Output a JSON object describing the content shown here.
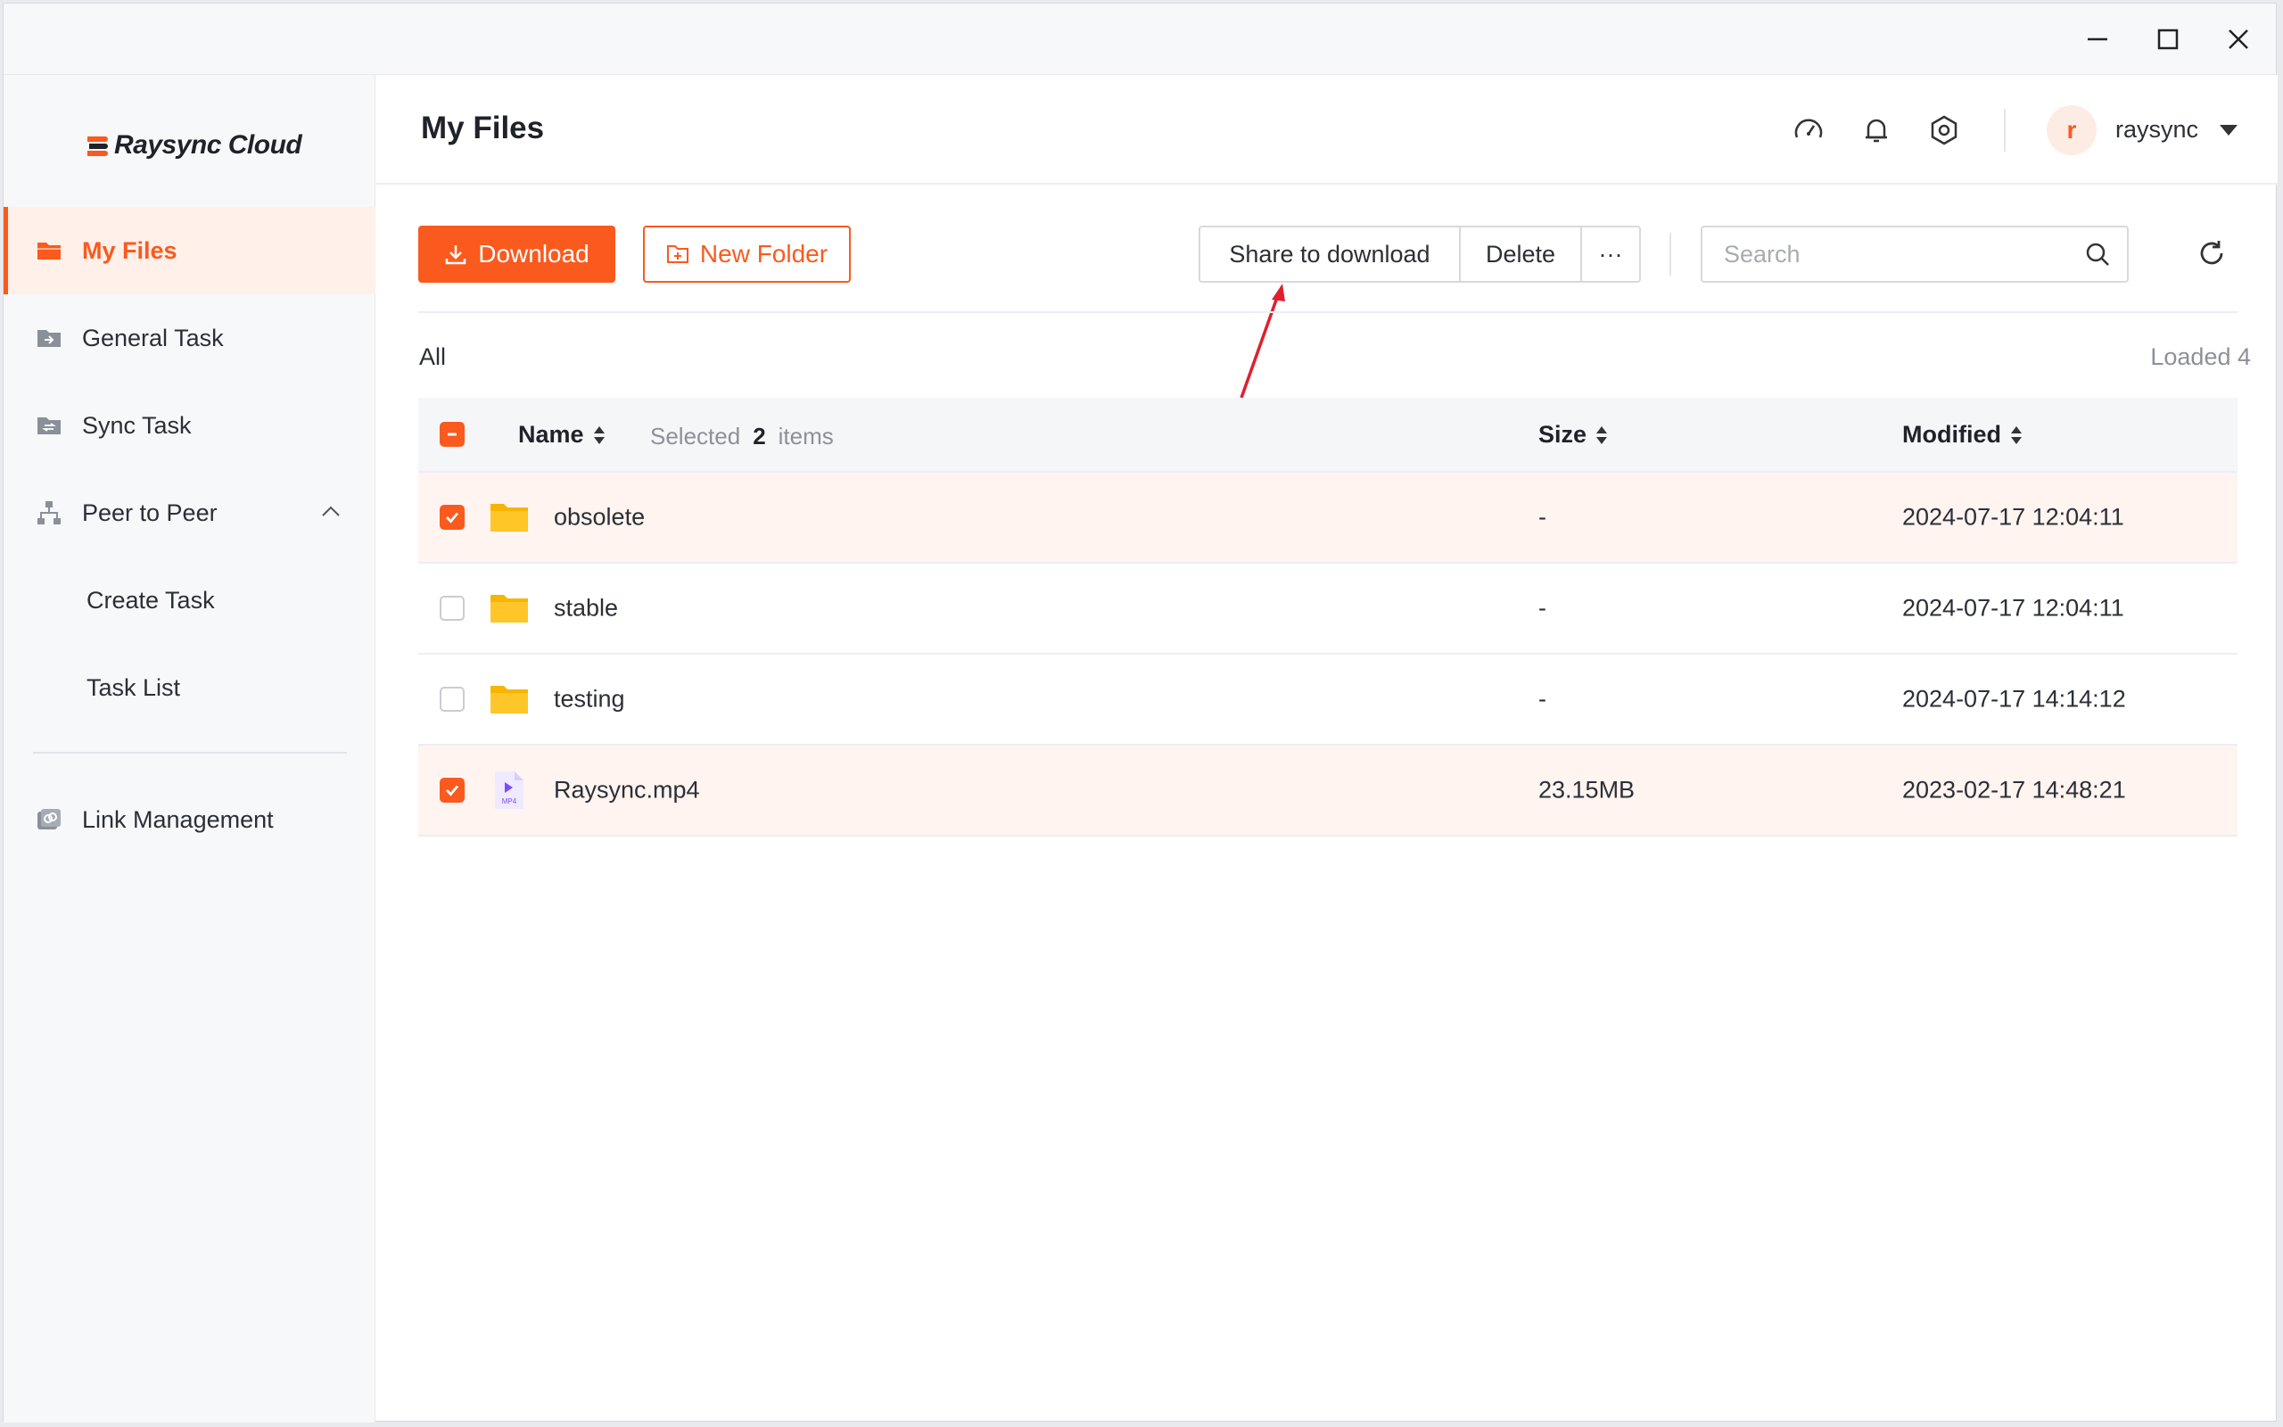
{
  "window": {
    "minimize": "minimize",
    "maximize": "maximize",
    "close": "close"
  },
  "brand": {
    "name": "Raysync Cloud",
    "color": "#fa5a1e"
  },
  "sidebar": {
    "items": [
      {
        "label": "My Files",
        "icon": "folder-icon"
      },
      {
        "label": "General Task",
        "icon": "general-task-icon"
      },
      {
        "label": "Sync Task",
        "icon": "sync-task-icon"
      },
      {
        "label": "Peer to Peer",
        "icon": "network-icon"
      },
      {
        "label": "Create Task"
      },
      {
        "label": "Task List"
      },
      {
        "label": "Link Management",
        "icon": "link-icon"
      }
    ]
  },
  "header": {
    "title": "My Files",
    "icons": [
      "speed-icon",
      "bell-icon",
      "settings-icon"
    ],
    "avatar_letter": "r",
    "username": "raysync"
  },
  "toolbar": {
    "download_label": "Download",
    "new_folder_label": "New Folder",
    "share_label": "Share to download",
    "delete_label": "Delete",
    "more_label": "···",
    "search_placeholder": "Search"
  },
  "breadcrumb": {
    "all": "All"
  },
  "loaded": "Loaded 4",
  "table": {
    "columns": {
      "name": "Name",
      "size": "Size",
      "modified": "Modified"
    },
    "selected_prefix": "Selected",
    "selected_count": "2",
    "selected_suffix": "items",
    "rows": [
      {
        "name": "obsolete",
        "type": "folder",
        "size": "-",
        "modified": "2024-07-17 12:04:11",
        "checked": true
      },
      {
        "name": "stable",
        "type": "folder",
        "size": "-",
        "modified": "2024-07-17 12:04:11",
        "checked": false
      },
      {
        "name": "testing",
        "type": "folder",
        "size": "-",
        "modified": "2024-07-17 14:14:12",
        "checked": false
      },
      {
        "name": "Raysync.mp4",
        "type": "video",
        "size": "23.15MB",
        "modified": "2023-02-17 14:48:21",
        "checked": true
      }
    ]
  },
  "file_icon_label": "MP4"
}
